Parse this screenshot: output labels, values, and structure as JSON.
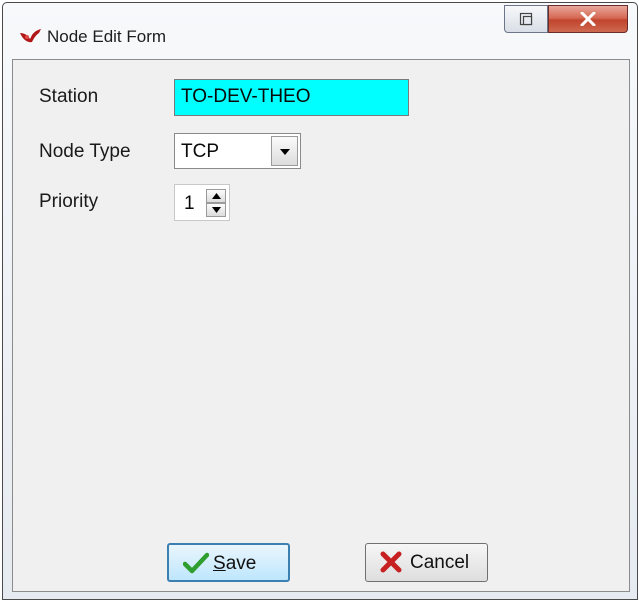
{
  "window": {
    "title": "Node Edit Form"
  },
  "form": {
    "station_label": "Station",
    "station_value": "TO-DEV-THEO",
    "node_type_label": "Node Type",
    "node_type_value": "TCP",
    "priority_label": "Priority",
    "priority_value": "1"
  },
  "buttons": {
    "save_mnemonic": "S",
    "save_rest": "ave",
    "cancel_label": "Cancel"
  },
  "colors": {
    "station_background": "#00ffff",
    "close_button": "#c8463a",
    "save_check": "#2e9e2e",
    "cancel_x": "#c62020"
  },
  "icons": {
    "title": "app-logo-icon",
    "restore": "restore-icon",
    "close": "close-icon",
    "dropdown": "dropdown-arrow-icon",
    "spin_up": "spin-up-icon",
    "spin_down": "spin-down-icon",
    "save": "check-icon",
    "cancel": "x-icon"
  }
}
